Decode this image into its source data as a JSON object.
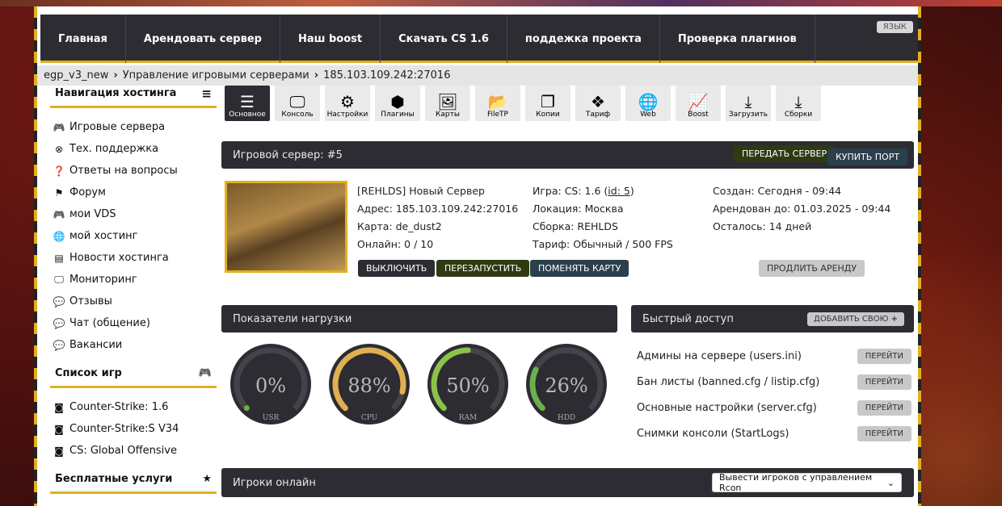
{
  "nav": {
    "items": [
      "Главная",
      "Арендовать сервер",
      "Наш boost",
      "Скачать CS 1.6",
      "поддежка проекта",
      "Проверка плагинов"
    ],
    "lang": "ЯЗЫК"
  },
  "breadcrumb": [
    "egp_v3_new",
    "Управление игровыми серверами",
    "185.103.109.242:27016"
  ],
  "sidebar": {
    "hosting_title": "Навигация хостинга",
    "hosting_items": [
      {
        "label": "Игровые сервера",
        "icon": "gamepad-icon"
      },
      {
        "label": "Тех. поддержка",
        "icon": "lifebuoy-icon"
      },
      {
        "label": "Ответы на вопросы",
        "icon": "question-icon"
      },
      {
        "label": "Форум",
        "icon": "flag-icon"
      },
      {
        "label": "мои VDS",
        "icon": "gamepad-icon"
      },
      {
        "label": "мой хостинг",
        "icon": "globe-icon"
      },
      {
        "label": "Новости хостинга",
        "icon": "newspaper-icon"
      },
      {
        "label": "Мониторинг",
        "icon": "monitor-icon"
      },
      {
        "label": "Отзывы",
        "icon": "comments-icon"
      },
      {
        "label": "Чат (общение)",
        "icon": "comments-icon"
      },
      {
        "label": "Вакансии",
        "icon": "comments-icon"
      }
    ],
    "games_title": "Список игр",
    "games_items": [
      "Counter-Strike: 1.6",
      "Counter-Strike:S V34",
      "CS: Global Offensive"
    ],
    "free_title": "Бесплатные услуги"
  },
  "toolbar": [
    "Основное",
    "Консоль",
    "Настройки",
    "Плагины",
    "Карты",
    "FileTP",
    "Копии",
    "Тариф",
    "Web",
    "Boost",
    "Загрузить",
    "Сборки"
  ],
  "server": {
    "header": "Игровой сервер: #5",
    "transfer_btn": "ПЕРЕДАТЬ СЕРВЕР",
    "buy_port_btn": "КУПИТЬ ПОРТ",
    "col1": [
      "[REHLDS] Новый Сервер",
      "Адрес: 185.103.109.242:27016",
      "Карта: de_dust2",
      "Онлайн: 0 / 10"
    ],
    "game_prefix": "Игра: CS: 1.6 (",
    "game_id": "id: 5",
    "game_suffix": ")",
    "col2": [
      "Локация: Москва",
      "Сборка: REHLDS",
      "Тариф: Обычный / 500 FPS"
    ],
    "col3": [
      "Создан: Сегодня - 09:44",
      "Арендован до: 01.03.2025 - 09:44",
      "Осталось: 14 дней"
    ],
    "btn_off": "ВЫКЛЮЧИТЬ",
    "btn_restart": "ПЕРЕЗАПУСТИТЬ",
    "btn_map": "ПОМЕНЯТЬ КАРТУ",
    "btn_extend": "ПРОДЛИТЬ АРЕНДУ"
  },
  "load": {
    "header": "Показатели нагрузки",
    "gauges": [
      {
        "value": "0%",
        "label": "USR",
        "percent": 0,
        "color": "#6ab04c"
      },
      {
        "value": "88%",
        "label": "CPU",
        "percent": 88,
        "color": "#e0b050"
      },
      {
        "value": "50%",
        "label": "RAM",
        "percent": 50,
        "color": "#8bc34a"
      },
      {
        "value": "26%",
        "label": "HDD",
        "percent": 26,
        "color": "#6ab04c"
      }
    ]
  },
  "quick": {
    "header": "Быстрый доступ",
    "add_btn": "ДОБАВИТЬ СВОЮ",
    "rows": [
      {
        "label": "Админы на сервере (users.ini)",
        "btn": "ПЕРЕЙТИ"
      },
      {
        "label": "Бан листы (banned.cfg / listip.cfg)",
        "btn": "ПЕРЕЙТИ"
      },
      {
        "label": "Основные настройки (server.cfg)",
        "btn": "ПЕРЕЙТИ"
      },
      {
        "label": "Снимки консоли (StartLogs)",
        "btn": "ПЕРЕЙТИ"
      }
    ]
  },
  "players": {
    "header": "Игроки онлайн",
    "select_value": "Вывести игроков с управлением Rcon"
  }
}
